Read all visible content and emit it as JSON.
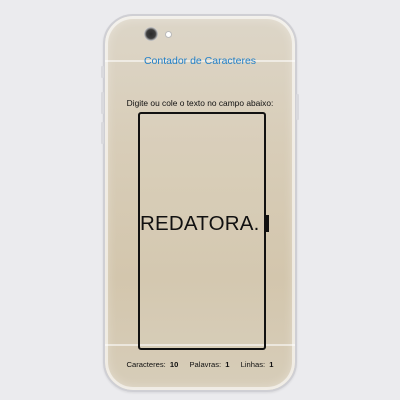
{
  "app": {
    "title": "Contador de Caracteres",
    "instructions": "Digite ou cole o texto no campo abaixo:"
  },
  "editor": {
    "text": "REDATORA."
  },
  "stats": {
    "characters_label": "Caracteres:",
    "characters_value": "10",
    "words_label": "Palavras:",
    "words_value": "1",
    "lines_label": "Linhas:",
    "lines_value": "1"
  },
  "colors": {
    "title": "#1f7fc9",
    "text": "#111111"
  }
}
